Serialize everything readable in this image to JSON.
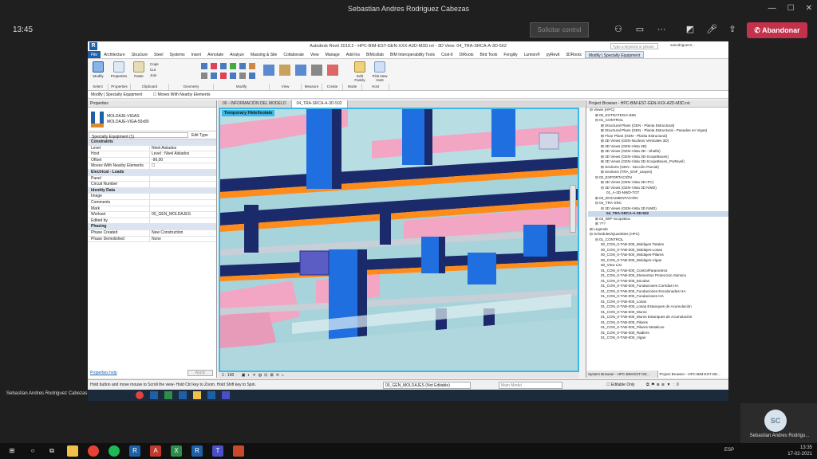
{
  "teams": {
    "title": "Sebastian Andres Rodriguez Cabezas",
    "timer": "13:45",
    "request_control": "Solicitar control",
    "leave": "Abandonar",
    "presenter_name": "Sebastian Andres Rodriguez Cabezas",
    "self_initials": "SC",
    "self_name": "Sebastian Andres Rodrigu..."
  },
  "revit": {
    "title": "Autodesk Revit 2019.2 - HPC-BIM-EST-GEN-XXX-A2D-M3D.rvt - 3D View: 04_TRA-SRCA-A-3D-502",
    "search_placeholder": "Type a keyword or phrase",
    "user": "sanodriguez3...",
    "tabs": [
      "File",
      "Architecture",
      "Structure",
      "Steel",
      "Systems",
      "Insert",
      "Annotate",
      "Analyze",
      "Massing & Site",
      "Collaborate",
      "View",
      "Manage",
      "Add-Ins",
      "BIMcollab",
      "BIM Interoperability Tools",
      "Cost-It",
      "DiRoots",
      "Bird Tools",
      "Fongilly",
      "Lumion®",
      "pyRevit",
      "3DRoots",
      "Modify | Specialty Equipment"
    ],
    "ribbon_groups": [
      "Select",
      "Properties",
      "Clipboard",
      "Geometry",
      "Modify",
      "View",
      "Measure",
      "Create",
      "Mode",
      "Host"
    ],
    "ribbon_buttons": {
      "modify": "Modify",
      "properties": "Properties",
      "paste": "Paste",
      "cope": "Cope",
      "cut": "Cut",
      "join": "Join",
      "edit_family": "Edit Family",
      "pick_new_host": "Pick New Host"
    },
    "context_bar": "Modify | Specialty Equipment",
    "moves_with_nearby": "Moves With Nearby Elements"
  },
  "properties": {
    "header": "Properties",
    "family": "MOLDAJE-VIGAS",
    "type": "MOLDAJE-VIGA-50x80",
    "selector": "Specialty Equipment (1)",
    "edit_type": "Edit Type",
    "rows": [
      {
        "k": "Constraints",
        "v": "",
        "sec": true
      },
      {
        "k": "Level",
        "v": "Nivel Aislados"
      },
      {
        "k": "Host",
        "v": "Level : Nivel Aislados"
      },
      {
        "k": "Offset",
        "v": "-96,00"
      },
      {
        "k": "Moves With Nearby Elements",
        "v": "☐"
      },
      {
        "k": "Electrical - Loads",
        "v": "",
        "sec": true
      },
      {
        "k": "Panel",
        "v": ""
      },
      {
        "k": "Circuit Number",
        "v": ""
      },
      {
        "k": "Identity Data",
        "v": "",
        "sec": true
      },
      {
        "k": "Image",
        "v": ""
      },
      {
        "k": "Comments",
        "v": ""
      },
      {
        "k": "Mark",
        "v": ""
      },
      {
        "k": "Workset",
        "v": "00_GEN_MOLDAJES"
      },
      {
        "k": "Edited by",
        "v": ""
      },
      {
        "k": "Phasing",
        "v": "",
        "sec": true
      },
      {
        "k": "Phase Created",
        "v": "New Construction"
      },
      {
        "k": "Phase Demolished",
        "v": "None"
      }
    ],
    "help": "Properties help",
    "apply": "Apply"
  },
  "view_tabs": [
    "00 - INFORMACIÓN DEL MODELO",
    "04_TRA-SRCA-A-3D-502"
  ],
  "canvas": {
    "badge": "Temporary Hide/Isolate",
    "scale": "1 : 100"
  },
  "browser": {
    "header": "Project Browser - HPC-BIM-EST-GEN-XXX-A2D-M3D.rvt",
    "items": [
      {
        "t": "⊟ Views (HPC)",
        "d": 0
      },
      {
        "t": "⊞ 00_ESTRATEGIA BIM",
        "d": 1
      },
      {
        "t": "⊟ 01_CONTROL",
        "d": 1
      },
      {
        "t": "⊞ Structural Plans (GEN - Planta Estructural)",
        "d": 2
      },
      {
        "t": "⊞ Structural Plans (GEN - Planta Estructural - Pasadas en Vigas)",
        "d": 2
      },
      {
        "t": "⊞ Floor Plans (GEN - Planta Estructural)",
        "d": 2
      },
      {
        "t": "⊞ 3D Views (GEN-Nucleos Verticales 3D)",
        "d": 2
      },
      {
        "t": "⊞ 3D Views (GEN-Vista 3D)",
        "d": 2
      },
      {
        "t": "⊞ 3D Views (GEN-Vista 3D - Shafts)",
        "d": 2
      },
      {
        "t": "⊞ 3D Views (GEN-Vista 3D-ScopeBoxes)",
        "d": 2
      },
      {
        "t": "⊞ 3D Views (GEN-Vista 3D-ScopeBoxes_PorNivel)",
        "d": 2
      },
      {
        "t": "⊞ Sections (GEN - Sección Parcial)",
        "d": 2
      },
      {
        "t": "⊞ Sections (TRA_ENF_arayes)",
        "d": 2
      },
      {
        "t": "⊟ 02_EXPORTACIÓN",
        "d": 1
      },
      {
        "t": "⊞ 3D Views (GEN-Vista 3D IFC)",
        "d": 2
      },
      {
        "t": "⊟ 3D Views (GEN-Vista 3D NWD)",
        "d": 2
      },
      {
        "t": "01_A-3D-NWD-TOT",
        "d": 3
      },
      {
        "t": "⊞ 03_DOCUMENTACIÓN",
        "d": 1
      },
      {
        "t": "⊟ 04_TRA-SRC",
        "d": 1
      },
      {
        "t": "⊟ 3D Views (GEN-Vista 3D NWD)",
        "d": 2
      },
      {
        "t": "04_TRA-SRCA-A-3D-502",
        "d": 3,
        "sel": true
      },
      {
        "t": "⊞ 04_WIP-ScopeBox",
        "d": 1
      },
      {
        "t": "⊞ ???",
        "d": 1
      },
      {
        "t": "⊞ Legends",
        "d": 0
      },
      {
        "t": "⊟ Schedules/Quantities (HPC)",
        "d": 0
      },
      {
        "t": "⊟ 01_CONTROL",
        "d": 1
      },
      {
        "t": "00_CON_0-TAB-000_Moldajes Totales",
        "d": 2
      },
      {
        "t": "00_CON_0-TAB-000_Moldajes-Losas",
        "d": 2
      },
      {
        "t": "00_CON_0-TAB-000_Moldajes-Pilares",
        "d": 2
      },
      {
        "t": "00_CON_0-TAB-000_Moldajes-Vigas",
        "d": 2
      },
      {
        "t": "00_View List",
        "d": 2
      },
      {
        "t": "01_CON_0-TAB-000_ControlParametros",
        "d": 2
      },
      {
        "t": "01_CON_0-TAB-000_Elementos Proteccion Sismica",
        "d": 2
      },
      {
        "t": "01_CON_0-TAB-000_Escalas",
        "d": 2
      },
      {
        "t": "01_CON_0-TAB-000_Fundaciones Corridas HA",
        "d": 2
      },
      {
        "t": "01_CON_0-TAB-000_Fundaciones Escalonadas HA",
        "d": 2
      },
      {
        "t": "01_CON_0-TAB-000_Fundaciones HA",
        "d": 2
      },
      {
        "t": "01_CON_0-TAB-000_Losas",
        "d": 2
      },
      {
        "t": "01_CON_0-TAB-000_Losas Estanques de Acumulación",
        "d": 2
      },
      {
        "t": "01_CON_0-TAB-000_Muros",
        "d": 2
      },
      {
        "t": "01_CON_0-TAB-000_Muros Estanques de Acumulación",
        "d": 2
      },
      {
        "t": "01_CON_0-TAB-000_Pilares",
        "d": 2
      },
      {
        "t": "01_CON_0-TAB-000_Pilares Metalicos",
        "d": 2
      },
      {
        "t": "01_CON_0-TAB-000_Radiers",
        "d": 2
      },
      {
        "t": "01_CON_0-TAB-000_Vigas",
        "d": 2
      }
    ],
    "bottom_tabs": [
      "System Browser - HPC-BIM-EST-GE...",
      "Project Browser - HPC-BIM-EST-GE..."
    ]
  },
  "status": {
    "hint": "Hold button and move mouse to Scroll the view- Hold Ctrl key to Zoom. Hold Shift key to Spin.",
    "workset": "00_GEN_MOLDAJES (Not Editable)",
    "editable_only": "Editable Only",
    "model": "Main Model"
  },
  "tray": {
    "lang": "ESP",
    "time": "13:35",
    "date": "17-02-2021"
  },
  "colors": {
    "accent": "#1d60a8",
    "leave": "#c4314b",
    "select": "#3cb7e6",
    "orange": "#ff8c1a",
    "pink": "#f2a6c4",
    "blue": "#1f6fe0",
    "navy": "#1a2a6a",
    "teal": "#a9d6dd"
  }
}
